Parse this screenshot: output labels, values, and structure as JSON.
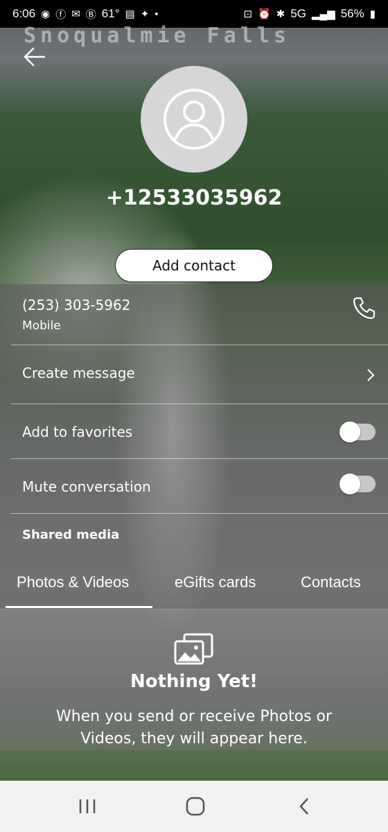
{
  "status_bar": {
    "time": "6:06",
    "temperature": "61°",
    "network": "5G",
    "battery": "56%"
  },
  "background": {
    "watermark": "Snoqualmie Falls"
  },
  "contact": {
    "phone_number": "+12533035962",
    "add_contact_label": "Add contact"
  },
  "details": {
    "number": "(253) 303-5962",
    "number_type": "Mobile",
    "create_message": "Create message",
    "add_to_favorites": "Add to favorites",
    "favorites_on": false,
    "mute_conversation": "Mute conversation",
    "mute_on": false,
    "shared_media": "Shared media"
  },
  "tabs": [
    {
      "label": "Photos & Videos",
      "active": true
    },
    {
      "label": "eGifts cards",
      "active": false
    },
    {
      "label": "Contacts",
      "active": false
    }
  ],
  "empty_state": {
    "title": "Nothing Yet!",
    "message": "When you send or receive Photos or Videos, they will appear here."
  },
  "icons": {
    "back": "arrow-left-icon",
    "avatar": "person-icon",
    "call": "phone-icon",
    "chevron": "chevron-right-icon",
    "media": "photos-icon"
  }
}
